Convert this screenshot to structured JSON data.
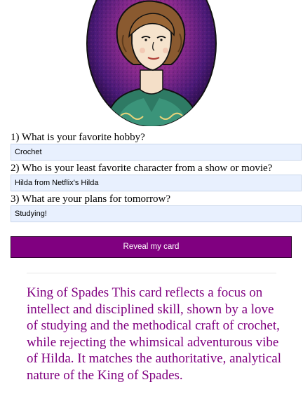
{
  "hero_image": {
    "icon": "portrait-woman-icon",
    "alt": "Vintage illustration of a woman in a purple circular frame"
  },
  "questions": [
    {
      "label": "1) What is your favorite hobby?",
      "answer": "Crochet"
    },
    {
      "label": "2) Who is your least favorite character from a show or movie?",
      "answer": "Hilda from Netflix's Hilda"
    },
    {
      "label": "3) What are your plans for tomorrow?",
      "answer": "Studying!"
    }
  ],
  "reveal_button": {
    "label": "Reveal my card"
  },
  "result": {
    "text": "King of Spades This card reflects a focus on intellect and disciplined skill, shown by a love of studying and the methodical craft of crochet, while rejecting the whimsical adventurous vibe of Hilda. It matches the authoritative, analytical nature of the King of Spades."
  },
  "colors": {
    "accent": "#800080",
    "input_background": "#e8f0fe",
    "result_text": "#800080"
  }
}
